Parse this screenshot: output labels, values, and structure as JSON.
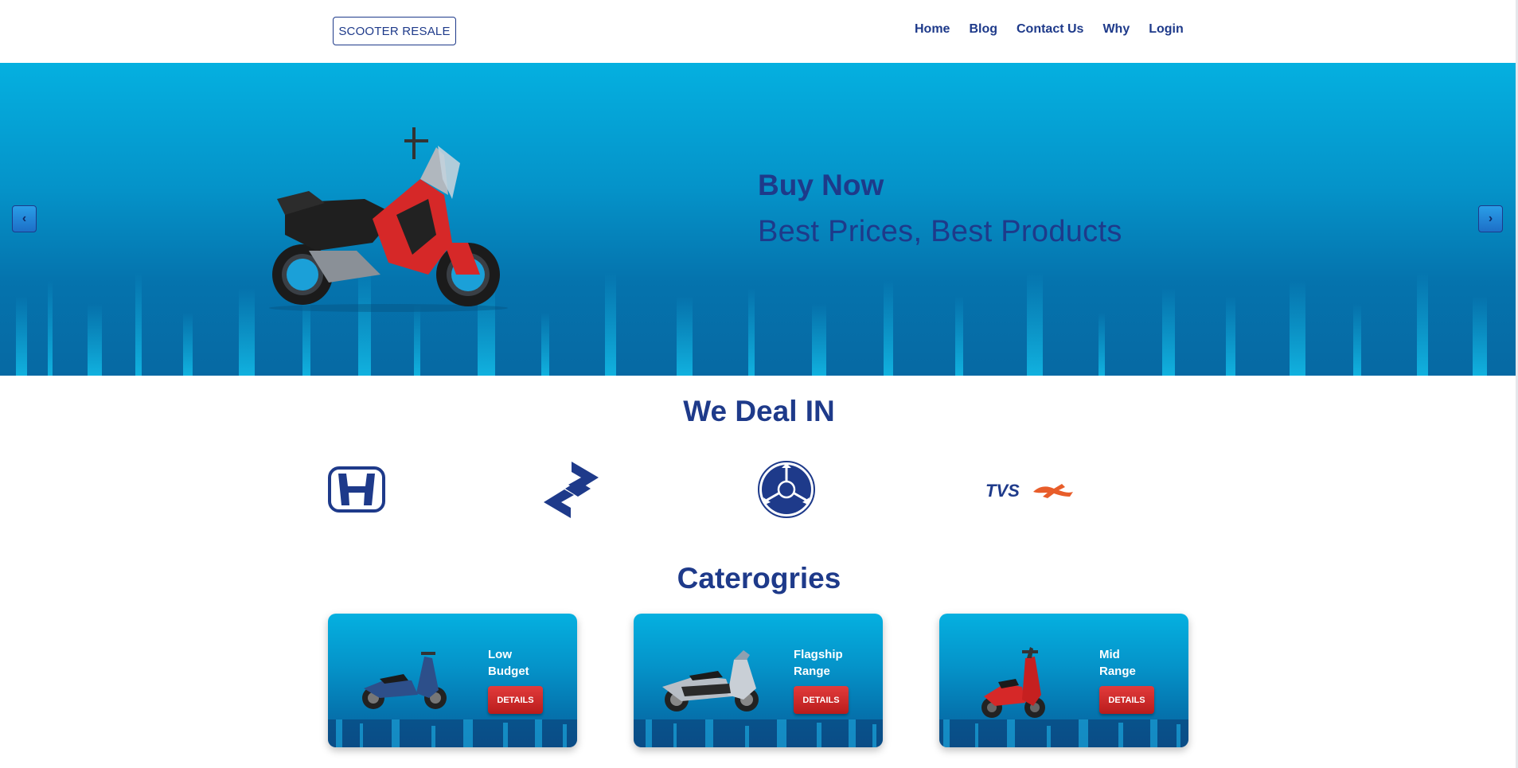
{
  "header": {
    "brand": "SCOOTER RESALE",
    "nav": [
      "Home",
      "Blog",
      "Contact Us",
      "Why",
      "Login"
    ]
  },
  "hero": {
    "title": "Buy Now",
    "subtitle": "Best Prices, Best Products",
    "prev_icon": "‹",
    "next_icon": "›"
  },
  "brands": {
    "title": "We Deal IN",
    "tvs_text": "TVS"
  },
  "categories": {
    "title": "Caterogries",
    "items": [
      {
        "line1": "Low",
        "line2": "Budget",
        "button": "DETAILS"
      },
      {
        "line1": "Flagship",
        "line2": "Range",
        "button": "DETAILS"
      },
      {
        "line1": "Mid",
        "line2": "Range",
        "button": "DETAILS"
      }
    ]
  },
  "colors": {
    "primary": "#1e3a8a",
    "hero_top": "#05b0e0",
    "hero_bottom": "#0669a3",
    "button_red": "#d32f2f"
  }
}
